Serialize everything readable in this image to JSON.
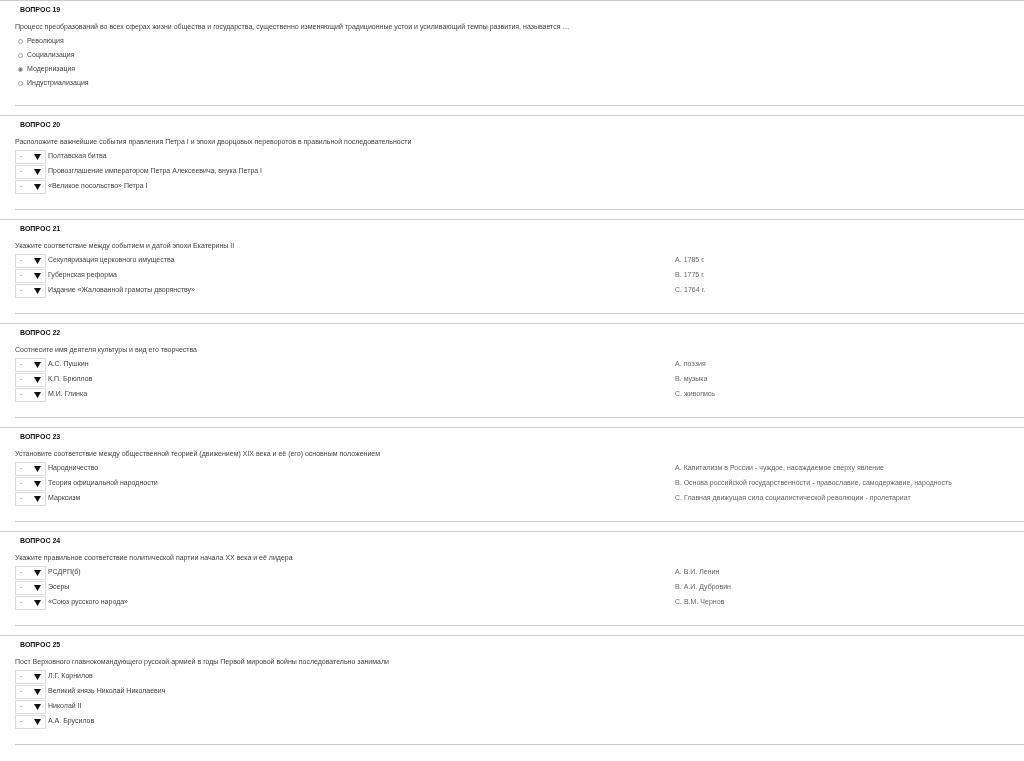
{
  "questions": [
    {
      "title": "ВОПРОС 19",
      "prompt": "Процесс преобразований во всех сферах жизни общества и государства, существенно изменяющий традиционные устои и усиливающий темпы развития, называется …",
      "kind": "radio",
      "options": [
        {
          "label": "Революция",
          "selected": false
        },
        {
          "label": "Социализация",
          "selected": false
        },
        {
          "label": "Модернизация",
          "selected": true
        },
        {
          "label": "Индустриализация",
          "selected": false
        }
      ]
    },
    {
      "title": "ВОПРОС 20",
      "prompt": "Расположите важнейшие события правления Петра I и эпохи дворцовых переворотов в правильной последовательности",
      "kind": "select",
      "items": [
        {
          "value": "-",
          "label": "Полтавская битва"
        },
        {
          "value": "-",
          "label": "Провозглашение императором Петра Алексеевича, внука Петра I"
        },
        {
          "value": "-",
          "label": "«Великое посольство» Петра I"
        }
      ]
    },
    {
      "title": "ВОПРОС 21",
      "prompt": "Укажите соответствие между событием и датой эпохи Екатерины II",
      "kind": "select",
      "items": [
        {
          "value": "-",
          "label": "Секуляризация  церковного имущества"
        },
        {
          "value": "-",
          "label": "Губернская реформа"
        },
        {
          "value": "-",
          "label": "Издание «Жалованной грамоты дворянству»"
        }
      ],
      "answers": [
        {
          "letter": "A.",
          "text": "1785 г."
        },
        {
          "letter": "B.",
          "text": "1775 г."
        },
        {
          "letter": "C.",
          "text": "1764 г."
        }
      ]
    },
    {
      "title": "ВОПРОС 22",
      "prompt": "Соотнесите имя деятеля культуры и вид его творчества",
      "kind": "select",
      "items": [
        {
          "value": "-",
          "label": "А.С. Пушкин"
        },
        {
          "value": "-",
          "label": "К.П. Брюллов"
        },
        {
          "value": "-",
          "label": "М.И. Глинка"
        }
      ],
      "answers": [
        {
          "letter": "A.",
          "text": "поэзия"
        },
        {
          "letter": "B.",
          "text": "музыка"
        },
        {
          "letter": "C.",
          "text": "живопись"
        }
      ]
    },
    {
      "title": "ВОПРОС 23",
      "prompt": "Установите соответствие между общественной теорией (движением) XIX века и её (его) основным положением",
      "kind": "select",
      "items": [
        {
          "value": "-",
          "label": "Народничество"
        },
        {
          "value": "-",
          "label": "Теория официальной народности"
        },
        {
          "value": "-",
          "label": "Марксизм"
        }
      ],
      "answers": [
        {
          "letter": "A.",
          "text": "Капитализм в России - чуждое, насаждаемое сверху явление"
        },
        {
          "letter": "B.",
          "text": "Основа российской государственности - православие, самодержавие, народность"
        },
        {
          "letter": "C.",
          "text": "Главная движущая сила социалистической революции - пролетариат"
        }
      ]
    },
    {
      "title": "ВОПРОС 24",
      "prompt": "Укажите правильное соответствие политической партии начала XX века и её лидера",
      "kind": "select",
      "items": [
        {
          "value": "-",
          "label": "РСДРП(б)"
        },
        {
          "value": "-",
          "label": "Эсеры"
        },
        {
          "value": "-",
          "label": "«Союз русского народа»"
        }
      ],
      "answers": [
        {
          "letter": "A.",
          "text": "В.И. Ленин"
        },
        {
          "letter": "B.",
          "text": "А.И. Дубровин"
        },
        {
          "letter": "C.",
          "text": "В.М. Чернов"
        }
      ]
    },
    {
      "title": "ВОПРОС 25",
      "prompt": "Пост Верховного главнокомандующего русской армией в годы Первой мировой войны последовательно занимали",
      "kind": "select",
      "items": [
        {
          "value": "-",
          "label": "Л.Г. Корнилов"
        },
        {
          "value": "-",
          "label": "Великий князь Николай Николаевич"
        },
        {
          "value": "-",
          "label": "Николай II"
        },
        {
          "value": "-",
          "label": "А.А. Брусилов"
        }
      ]
    }
  ]
}
